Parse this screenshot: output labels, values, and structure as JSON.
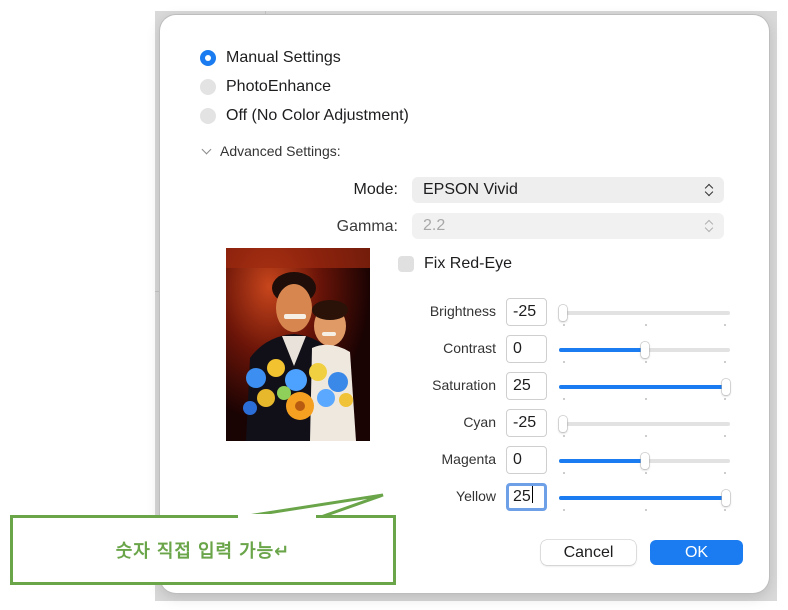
{
  "color_mode": {
    "options": [
      {
        "label": "Manual Settings",
        "selected": true
      },
      {
        "label": "PhotoEnhance",
        "selected": false
      },
      {
        "label": "Off (No Color Adjustment)",
        "selected": false
      }
    ]
  },
  "advanced": {
    "toggle_label": "Advanced Settings:",
    "mode_label": "Mode:",
    "mode_value": "EPSON Vivid",
    "gamma_label": "Gamma:",
    "gamma_value": "2.2",
    "fix_red_eye_label": "Fix Red-Eye",
    "fix_red_eye_checked": false,
    "sliders": [
      {
        "label": "Brightness",
        "value": "-25",
        "level": 0.0
      },
      {
        "label": "Contrast",
        "value": "0",
        "level": 0.5
      },
      {
        "label": "Saturation",
        "value": "25",
        "level": 1.0
      },
      {
        "label": "Cyan",
        "value": "-25",
        "level": 0.0
      },
      {
        "label": "Magenta",
        "value": "0",
        "level": 0.5
      },
      {
        "label": "Yellow",
        "value": "25",
        "level": 1.0
      }
    ]
  },
  "buttons": {
    "cancel": "Cancel",
    "ok": "OK"
  },
  "callout": {
    "text": "숫자 직접 입력 가능↵"
  },
  "colors": {
    "accent": "#1a7cf0",
    "callout_green": "#6aa54a",
    "focus_ring": "#6ea0e8"
  },
  "icons": {
    "popup": "up-down-chevron-icon",
    "disclosure": "chevron-down-icon"
  }
}
